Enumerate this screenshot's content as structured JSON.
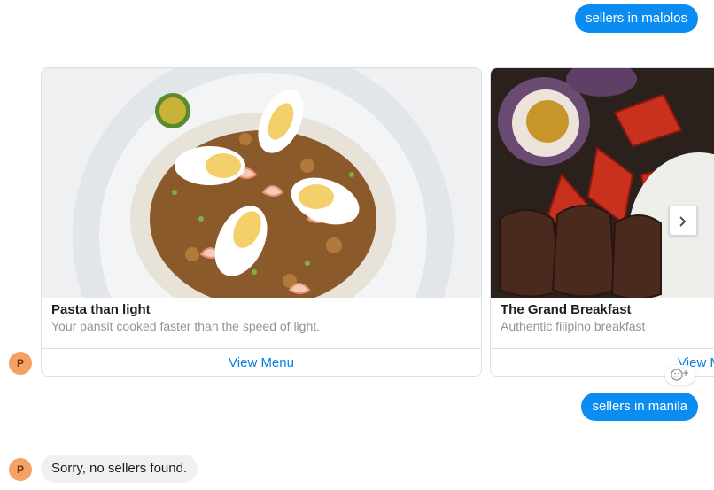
{
  "messages": {
    "outgoing_1": "sellers in malolos",
    "outgoing_2": "sellers in manila",
    "incoming_reply": "Sorry, no sellers found."
  },
  "bot": {
    "avatar_initial": "P",
    "avatar_color": "#f4a165"
  },
  "carousel": {
    "cards": [
      {
        "title": "Pasta than light",
        "subtitle": "Your pansit cooked faster than the speed of light.",
        "button": "View Menu"
      },
      {
        "title": "The Grand Breakfast",
        "subtitle": "Authentic filipino breakfast",
        "button": "View Menu"
      }
    ],
    "next_icon": "chevron-right-icon"
  },
  "reaction": {
    "icon": "add-reaction-icon"
  },
  "colors": {
    "outgoing_bubble": "#0a8cf0",
    "incoming_bubble": "#f1f0f0",
    "link": "#0a7fdc",
    "muted_text": "#90949c"
  }
}
